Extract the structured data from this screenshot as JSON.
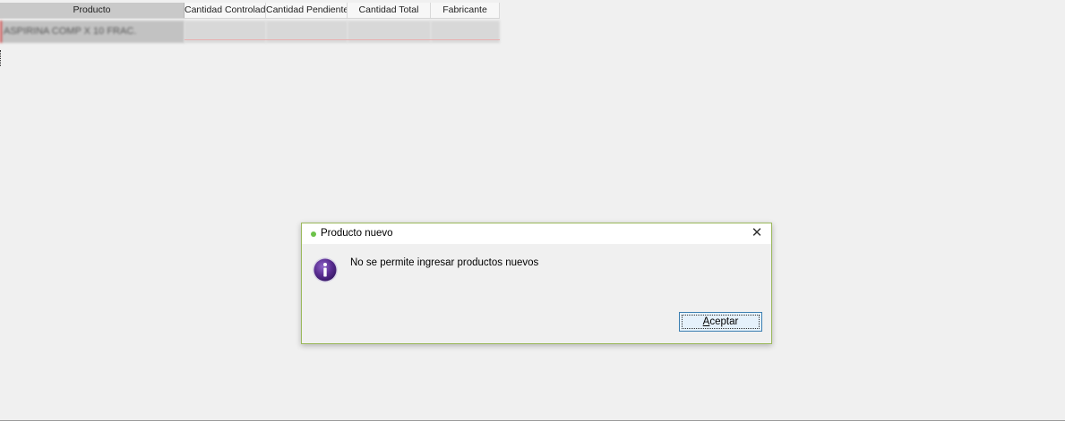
{
  "grid": {
    "columns": [
      "Producto",
      "Cantidad Controlada",
      "Cantidad Pendiente",
      "Cantidad Total",
      "Fabricante"
    ],
    "rows": [
      {
        "producto": "ASPIRINA   COMP X  10 FRAC."
      }
    ]
  },
  "dialog": {
    "title": "Producto nuevo",
    "close_glyph": "✕",
    "message": "No se permite ingresar productos nuevos",
    "ok_mnemonic": "A",
    "ok_rest": "ceptar",
    "icon": "info-icon"
  },
  "colors": {
    "dialog_border": "#9ab85a",
    "title_icon": "#6cc24a",
    "button_border": "#3c7fb1",
    "button_bg": "#e5f1fb",
    "info_icon": "#5a2d91"
  }
}
